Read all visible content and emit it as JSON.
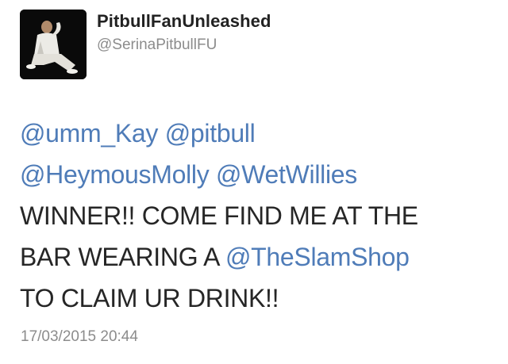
{
  "user": {
    "display_name": "PitbullFanUnleashed",
    "handle": "@SerinaPitbullFU"
  },
  "tweet": {
    "line1": {
      "mention1": "@umm_Kay",
      "mention2": "@pitbull"
    },
    "line2": {
      "mention1": "@HeymousMolly",
      "mention2": "@WetWillies"
    },
    "line3": {
      "text": "WINNER!! COME FIND ME AT THE"
    },
    "line4": {
      "text": "BAR WEARING A",
      "mention": "@TheSlamShop"
    },
    "line5": {
      "text": "TO CLAIM UR DRINK!!"
    }
  },
  "timestamp": "17/03/2015 20:44",
  "colors": {
    "mention": "#4f7cb8",
    "text": "#262626",
    "meta": "#8c8c8c"
  }
}
